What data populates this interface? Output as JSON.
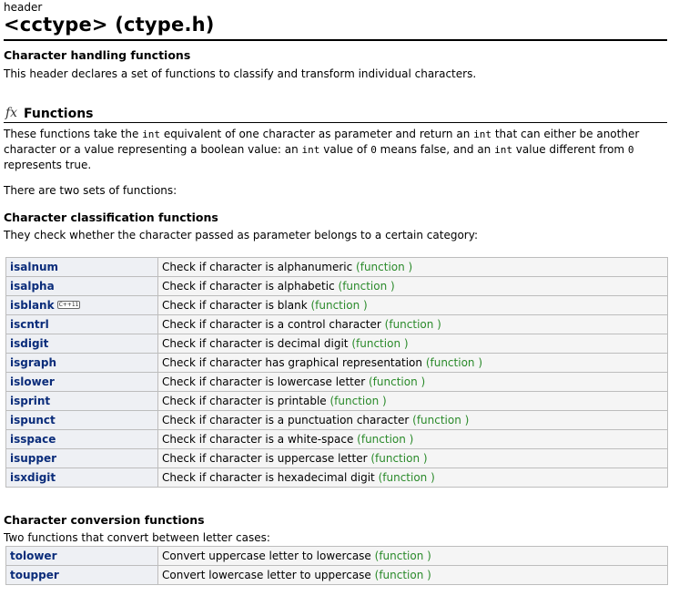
{
  "header": {
    "kind": "header",
    "title": "<cctype> (ctype.h)"
  },
  "intro": {
    "heading": "Character handling functions",
    "text": "This header declares a set of functions to classify and transform individual characters."
  },
  "functions_section": {
    "icon": "fx-icon",
    "heading": "Functions",
    "p1_a": "These functions take the ",
    "p1_code1": "int",
    "p1_b": " equivalent of one character as parameter and return an ",
    "p1_code2": "int",
    "p1_c": " that can either be another",
    "p2_a": "character or a value representing a boolean value: an ",
    "p2_code1": "int",
    "p2_b": " value of ",
    "p2_code2": "0",
    "p2_c": " means false, and an ",
    "p2_code3": "int",
    "p2_d": " value different from ",
    "p2_code4": "0",
    "p3": "represents true.",
    "sets_text": "There are two sets of functions:"
  },
  "classification": {
    "heading": "Character classification functions",
    "description": "They check whether the character passed as parameter belongs to a certain category:",
    "rows": [
      {
        "name": "isalnum",
        "desc": "Check if character is alphanumeric",
        "tag": "(function )"
      },
      {
        "name": "isalpha",
        "desc": "Check if character is alphabetic",
        "tag": "(function )"
      },
      {
        "name": "isblank",
        "badge": "C++11",
        "desc": "Check if character is blank",
        "tag": "(function )"
      },
      {
        "name": "iscntrl",
        "desc": "Check if character is a control character",
        "tag": "(function )"
      },
      {
        "name": "isdigit",
        "desc": "Check if character is decimal digit",
        "tag": "(function )"
      },
      {
        "name": "isgraph",
        "desc": "Check if character has graphical representation",
        "tag": "(function )"
      },
      {
        "name": "islower",
        "desc": "Check if character is lowercase letter",
        "tag": "(function )"
      },
      {
        "name": "isprint",
        "desc": "Check if character is printable",
        "tag": "(function )"
      },
      {
        "name": "ispunct",
        "desc": "Check if character is a punctuation character",
        "tag": "(function )"
      },
      {
        "name": "isspace",
        "desc": "Check if character is a white-space",
        "tag": "(function )"
      },
      {
        "name": "isupper",
        "desc": "Check if character is uppercase letter",
        "tag": "(function )"
      },
      {
        "name": "isxdigit",
        "desc": "Check if character is hexadecimal digit",
        "tag": "(function )"
      }
    ]
  },
  "conversion": {
    "heading": "Character conversion functions",
    "description": "Two functions that convert between letter cases:",
    "rows": [
      {
        "name": "tolower",
        "desc": "Convert uppercase letter to lowercase",
        "tag": "(function )"
      },
      {
        "name": "toupper",
        "desc": "Convert lowercase letter to uppercase",
        "tag": "(function )"
      }
    ]
  }
}
